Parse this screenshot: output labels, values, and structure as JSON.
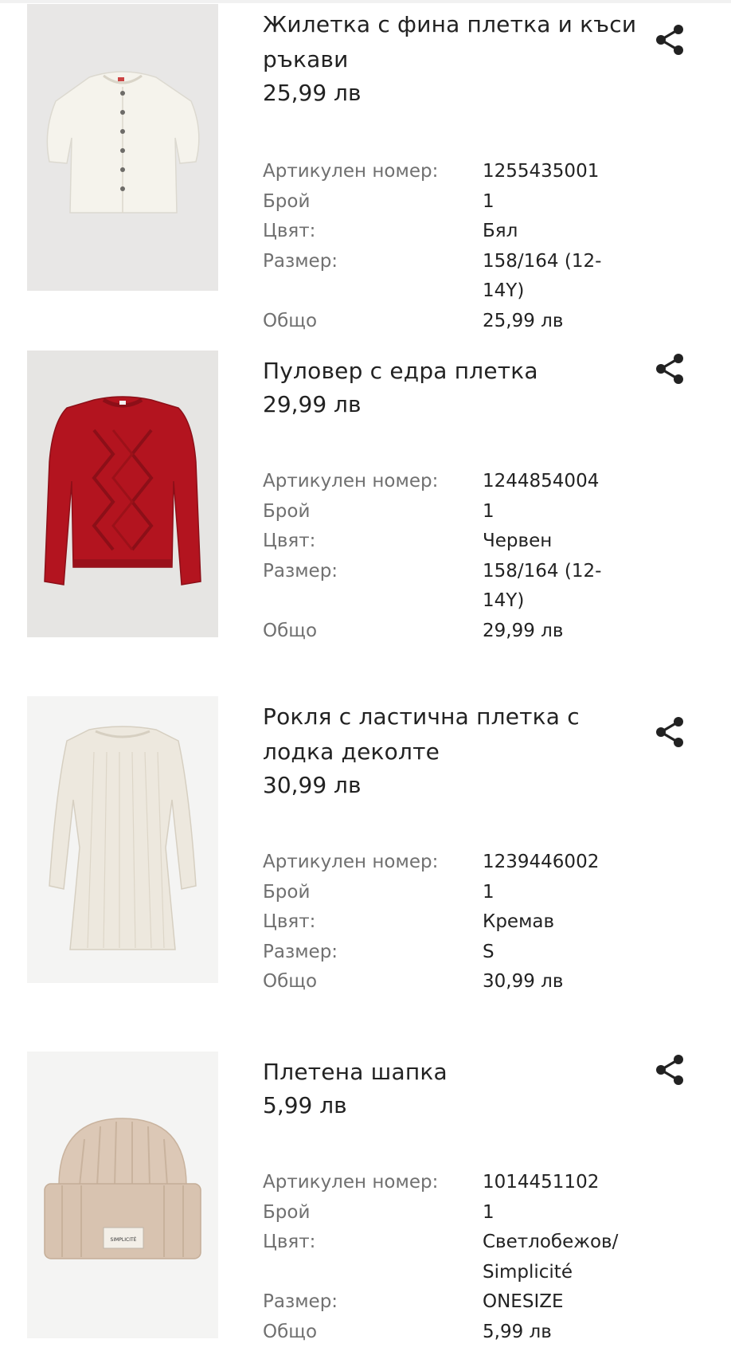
{
  "items": [
    {
      "name": "Жилетка с фина плетка и къси ръкави",
      "price": "25,99 лв",
      "details": {
        "article_label": "Артикулен номер:",
        "article": "1255435001",
        "qty_label": "Брой",
        "qty": "1",
        "color_label": "Цвят:",
        "color": "Бял",
        "size_label": "Размер:",
        "size": "158/164 (12-14Y)",
        "total_label": "Общо",
        "total": "25,99 лв"
      },
      "image": {
        "depicts": "cream-cardigan-image",
        "bg": "#e8e7e6",
        "garment": "#f5f3ec"
      }
    },
    {
      "name": "Пуловер с едра плетка",
      "price": "29,99 лв",
      "details": {
        "article_label": "Артикулен номер:",
        "article": "1244854004",
        "qty_label": "Брой",
        "qty": "1",
        "color_label": "Цвят:",
        "color": "Червен",
        "size_label": "Размер:",
        "size": "158/164 (12-14Y)",
        "total_label": "Общо",
        "total": "29,99 лв"
      },
      "image": {
        "depicts": "red-sweater-image",
        "bg": "#e6e5e3",
        "garment": "#b3141f"
      }
    },
    {
      "name": "Рокля с ластична плетка с лодка деколте",
      "price": "30,99 лв",
      "details": {
        "article_label": "Артикулен номер:",
        "article": "1239446002",
        "qty_label": "Брой",
        "qty": "1",
        "color_label": "Цвят:",
        "color": "Кремав",
        "size_label": "Размер:",
        "size": "S",
        "total_label": "Общо",
        "total": "30,99 лв"
      },
      "image": {
        "depicts": "knit-dress-image",
        "bg": "#f4f4f3",
        "garment": "#ede8de"
      }
    },
    {
      "name": "Плетена шапка",
      "price": "5,99 лв",
      "details": {
        "article_label": "Артикулен номер:",
        "article": "1014451102",
        "qty_label": "Брой",
        "qty": "1",
        "color_label": "Цвят:",
        "color": "Светлобежов/ Simplicité",
        "size_label": "Размер:",
        "size": "ONESIZE",
        "total_label": "Общо",
        "total": "5,99 лв"
      },
      "image": {
        "depicts": "beanie-image",
        "bg": "#f4f4f3",
        "garment": "#dcc8b6",
        "tag_text": "SIMPLICITÉ"
      }
    }
  ],
  "icons": {
    "share": "share-icon"
  },
  "colors": {
    "text": "#222222",
    "label": "#707070"
  }
}
